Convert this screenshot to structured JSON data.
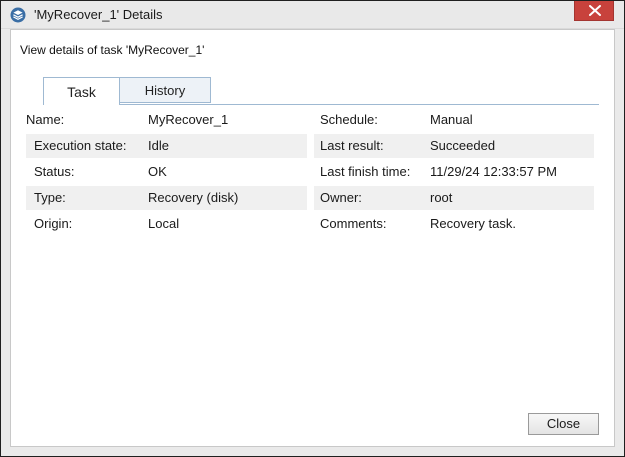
{
  "window": {
    "title": "'MyRecover_1' Details",
    "subtitle": "View details of task 'MyRecover_1'"
  },
  "tabs": [
    {
      "label": "Task",
      "active": true
    },
    {
      "label": "History",
      "active": false
    }
  ],
  "details": {
    "left": [
      {
        "label": "Name:",
        "value": "MyRecover_1"
      },
      {
        "label": "Execution state:",
        "value": "Idle"
      },
      {
        "label": "Status:",
        "value": "OK"
      },
      {
        "label": "Type:",
        "value": "Recovery (disk)"
      },
      {
        "label": "Origin:",
        "value": "Local"
      }
    ],
    "right": [
      {
        "label": "Schedule:",
        "value": "Manual"
      },
      {
        "label": "Last result:",
        "value": "Succeeded"
      },
      {
        "label": "Last finish time:",
        "value": "11/29/24 12:33:57 PM"
      },
      {
        "label": "Owner:",
        "value": "root"
      },
      {
        "label": "Comments:",
        "value": "Recovery task."
      }
    ]
  },
  "buttons": {
    "close_label": "Close"
  },
  "icons": {
    "app": "layers-icon",
    "close": "close-icon"
  },
  "colors": {
    "titlebar_close": "#c8423c",
    "tab_border": "#9fb9d2",
    "stripe": "#f0f0f0"
  }
}
